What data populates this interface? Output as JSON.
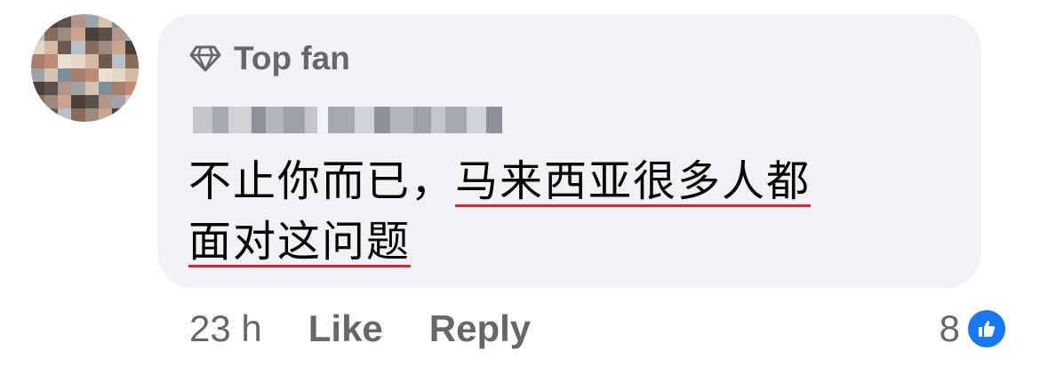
{
  "comment": {
    "badge_label": "Top fan",
    "author_name_redacted": "",
    "text_plain": "不止你而已，",
    "text_highlighted_1": "马来西亚很多人都",
    "text_highlighted_2": "面对这问题"
  },
  "actions": {
    "timestamp": "23 h",
    "like_label": "Like",
    "reply_label": "Reply"
  },
  "reactions": {
    "count": "8",
    "icon": "thumbs-up-icon"
  },
  "colors": {
    "bubble": "#f0f2f5",
    "underline": "#e0232e",
    "like_blue": "#1877f2",
    "secondary_text": "#65676b"
  }
}
